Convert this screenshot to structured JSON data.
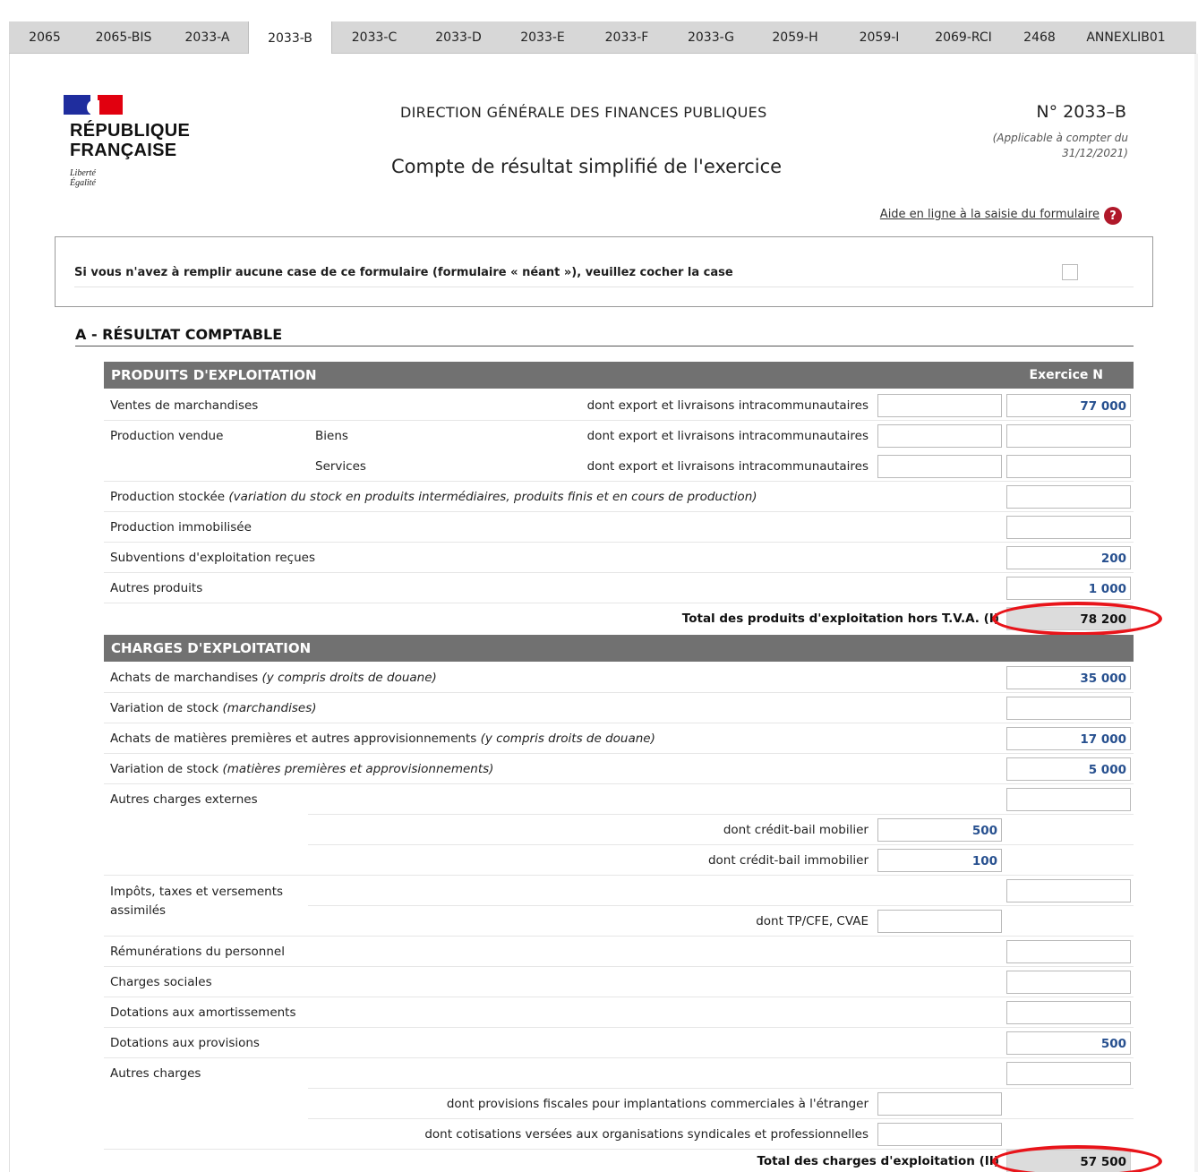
{
  "tabs": [
    "2065",
    "2065-BIS",
    "2033-A",
    "2033-B",
    "2033-C",
    "2033-D",
    "2033-E",
    "2033-F",
    "2033-G",
    "2059-H",
    "2059-I",
    "2069-RCI",
    "2468",
    "ANNEXLIB01"
  ],
  "active_tab": "2033-B",
  "header": {
    "logo_line1": "RÉPUBLIQUE",
    "logo_line2": "FRANÇAISE",
    "motto_line1": "Liberté",
    "motto_line2": "Égalité",
    "agency": "DIRECTION GÉNÉRALE DES FINANCES PUBLIQUES",
    "title": "Compte de résultat simplifié de l'exercice",
    "form_number": "N° 2033–B",
    "applicable_line1": "(Applicable à compter du",
    "applicable_line2": "31/12/2021)",
    "help_link": "Aide en ligne à la saisie du formulaire",
    "help_icon": "?"
  },
  "neant": {
    "text": "Si vous n'avez à remplir aucune case de ce formulaire (formulaire « néant »), veuillez cocher la case",
    "checked": false
  },
  "section": {
    "title": "A - RÉSULTAT COMPTABLE"
  },
  "produits": {
    "band_title": "PRODUITS D'EXPLOITATION",
    "col_header": "Exercice N",
    "ventes_label": "Ventes de marchandises",
    "dont_export": "dont export et livraisons intracommunautaires",
    "ventes_export_value": "",
    "ventes_value": "77 000",
    "production_vendue_label": "Production vendue",
    "biens_label": "Biens",
    "biens_export_value": "",
    "biens_value": "",
    "services_label": "Services",
    "services_export_value": "",
    "services_value": "",
    "production_stockee_label": "Production stockée",
    "production_stockee_note": "(variation du stock en produits intermédiaires, produits finis et en cours de production)",
    "production_stockee_value": "",
    "production_immobilisee_label": "Production immobilisée",
    "production_immobilisee_value": "",
    "subventions_label": "Subventions d'exploitation reçues",
    "subventions_value": "200",
    "autres_produits_label": "Autres produits",
    "autres_produits_value": "1 000",
    "total_label": "Total des produits d'exploitation hors T.V.A. (I)",
    "total_value": "78 200"
  },
  "charges": {
    "band_title": "CHARGES D'EXPLOITATION",
    "achats_march_label": "Achats de marchandises",
    "achats_march_note": "(y compris droits de douane)",
    "achats_march_value": "35 000",
    "var_stock_march_label": "Variation de stock",
    "var_stock_march_note": "(marchandises)",
    "var_stock_march_value": "",
    "achats_mp_label": "Achats de matières premières et autres approvisionnements",
    "achats_mp_note": "(y compris droits de douane)",
    "achats_mp_value": "17 000",
    "var_stock_mp_label": "Variation de stock",
    "var_stock_mp_note": "(matières premières et approvisionnements)",
    "var_stock_mp_value": "5 000",
    "autres_ext_label": "Autres charges externes",
    "autres_ext_value": "",
    "cb_mobilier_label": "dont crédit-bail mobilier",
    "cb_mobilier_value": "500",
    "cb_immobilier_label": "dont crédit-bail immobilier",
    "cb_immobilier_value": "100",
    "impots_label_1": "Impôts, taxes et versements",
    "impots_label_2": "assimilés",
    "impots_value": "",
    "tp_cfe_label": "dont TP/CFE, CVAE",
    "tp_cfe_value": "",
    "remunerations_label": "Rémunérations du personnel",
    "remunerations_value": "",
    "charges_sociales_label": "Charges sociales",
    "charges_sociales_value": "",
    "dot_amort_label": "Dotations aux amortissements",
    "dot_amort_value": "",
    "dot_prov_label": "Dotations aux provisions",
    "dot_prov_value": "500",
    "autres_charges_label": "Autres charges",
    "autres_charges_value": "",
    "prov_fiscales_label": "dont provisions fiscales pour implantations commerciales à l'étranger",
    "prov_fiscales_value": "",
    "cotisations_label": "dont cotisations versées aux organisations syndicales et professionnelles",
    "cotisations_value": "",
    "total_label": "Total des charges d'exploitation (II)",
    "total_value": "57 500"
  },
  "colors": {
    "band": "#717171",
    "value_text": "#27508f",
    "highlight": "#e8141a",
    "help_icon": "#b0182a",
    "marianne_blue": "#1f2d9e",
    "marianne_red": "#e1000f"
  }
}
